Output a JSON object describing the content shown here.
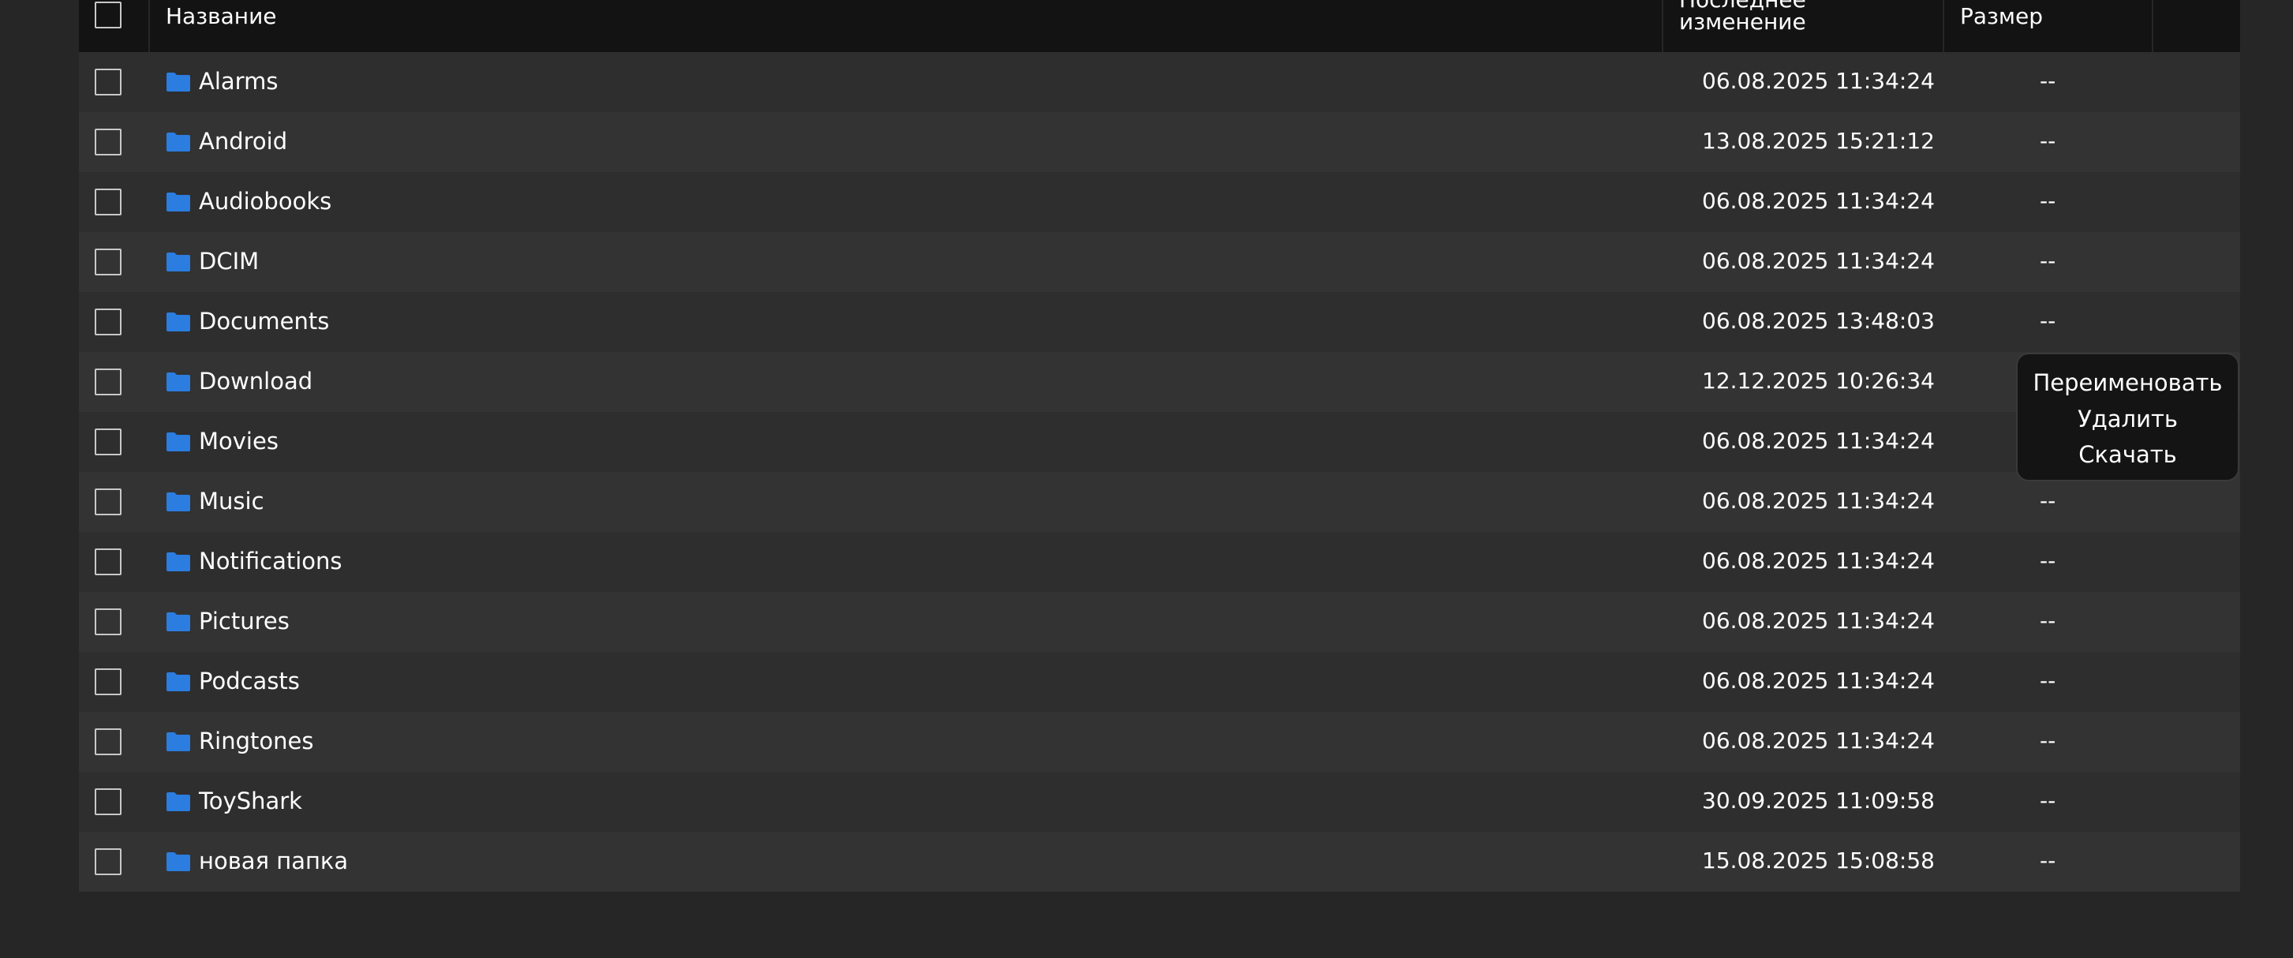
{
  "table": {
    "header": {
      "name": "Название",
      "modified": "Последнее изменение",
      "size": "Размер"
    },
    "rows": [
      {
        "name": "Alarms",
        "modified": "06.08.2025 11:34:24",
        "size": "--"
      },
      {
        "name": "Android",
        "modified": "13.08.2025 15:21:12",
        "size": "--"
      },
      {
        "name": "Audiobooks",
        "modified": "06.08.2025 11:34:24",
        "size": "--"
      },
      {
        "name": "DCIM",
        "modified": "06.08.2025 11:34:24",
        "size": "--"
      },
      {
        "name": "Documents",
        "modified": "06.08.2025 13:48:03",
        "size": "--"
      },
      {
        "name": "Download",
        "modified": "12.12.2025 10:26:34",
        "size": "--"
      },
      {
        "name": "Movies",
        "modified": "06.08.2025 11:34:24",
        "size": "--"
      },
      {
        "name": "Music",
        "modified": "06.08.2025 11:34:24",
        "size": "--"
      },
      {
        "name": "Notifications",
        "modified": "06.08.2025 11:34:24",
        "size": "--"
      },
      {
        "name": "Pictures",
        "modified": "06.08.2025 11:34:24",
        "size": "--"
      },
      {
        "name": "Podcasts",
        "modified": "06.08.2025 11:34:24",
        "size": "--"
      },
      {
        "name": "Ringtones",
        "modified": "06.08.2025 11:34:24",
        "size": "--"
      },
      {
        "name": "ToyShark",
        "modified": "30.09.2025 11:09:58",
        "size": "--"
      },
      {
        "name": "новая папка",
        "modified": "15.08.2025 15:08:58",
        "size": "--"
      }
    ]
  },
  "context_menu": {
    "items": [
      "Переименовать",
      "Удалить",
      "Скачать"
    ]
  },
  "icons": {
    "row_icon": "folder-icon"
  },
  "colors": {
    "folder": "#2b7de0",
    "background": "#262626",
    "header": "#131313",
    "row_odd": "#2e2e2e",
    "row_even": "#333333",
    "menu": "#141414"
  }
}
